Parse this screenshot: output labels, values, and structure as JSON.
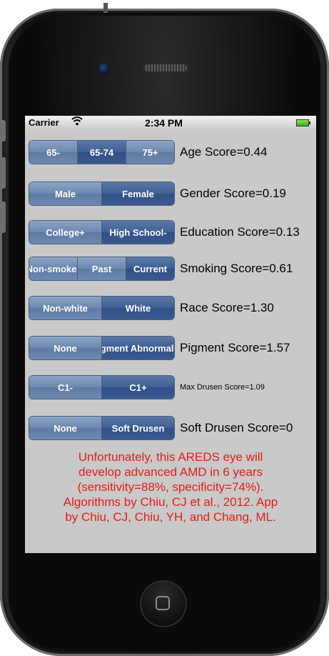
{
  "statusbar": {
    "carrier": "Carrier",
    "time": "2:34 PM",
    "wifi_icon": "wifi-icon",
    "battery_icon": "battery-icon"
  },
  "rows": [
    {
      "options": [
        "65-",
        "65-74",
        "75+"
      ],
      "selected": 1,
      "score": "Age Score=0.44"
    },
    {
      "options": [
        "Male",
        "Female"
      ],
      "selected": 1,
      "score": "Gender Score=0.19"
    },
    {
      "options": [
        "College+",
        "High School-"
      ],
      "selected": 1,
      "score": "Education Score=0.13"
    },
    {
      "options": [
        "Non-smoker",
        "Past",
        "Current"
      ],
      "selected": 2,
      "score": "Smoking Score=0.61"
    },
    {
      "options": [
        "Non-white",
        "White"
      ],
      "selected": 1,
      "score": "Race Score=1.30"
    },
    {
      "options": [
        "None",
        "Pigment Abnormality"
      ],
      "selected": 1,
      "score": "Pigment Score=1.57"
    },
    {
      "options": [
        "C1-",
        "C1+"
      ],
      "selected": 1,
      "score": "Max Drusen Score=1.09"
    },
    {
      "options": [
        "None",
        "Soft Drusen"
      ],
      "selected": 1,
      "score": "Soft Drusen Score=0"
    }
  ],
  "message": {
    "line1": "Unfortunately, this AREDS eye will",
    "line2": "develop advanced AMD in 6 years",
    "line3": "(sensitivity=88%, specificity=74%).",
    "line4": "Algorithms by Chiu, CJ et al., 2012. App",
    "line5": "by Chiu, CJ, Chiu, YH, and Chang, ML."
  },
  "colors": {
    "segment_normal": "#7a93b8",
    "segment_selected": "#3f5f94",
    "message": "#e31b1b",
    "screen_bg": "#c9c9c9"
  }
}
